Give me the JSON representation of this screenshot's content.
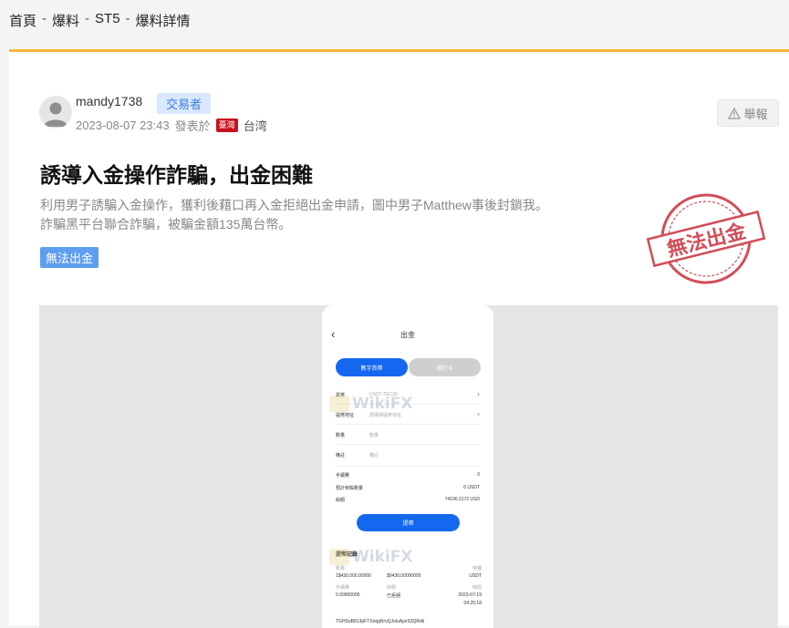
{
  "breadcrumb": {
    "items": [
      "首頁",
      "爆料",
      "ST5",
      "爆料詳情"
    ],
    "separator": "-"
  },
  "post": {
    "author": "mandy1738",
    "role": "交易者",
    "datetime": "2023-08-07 23:43",
    "posted_at_label": "發表於",
    "flag_text": "臺灣",
    "region": "台湾",
    "report_label": "舉報",
    "title": "誘導入金操作詐騙，出金困難",
    "description_line1": "利用男子誘騙入金操作，獲利後藉口再入金拒絕出金申請，圖中男子Matthew事後封鎖我。",
    "description_line2": "詐騙黑平台聯合詐騙，被騙金額135萬台幣。",
    "tag": "無法出金",
    "stamp_text": "無法出金"
  },
  "phone_screen": {
    "title": "出金",
    "back_icon": "chevron-left-icon",
    "tab_active": "數字貨幣",
    "tab_inactive": "銀行卡",
    "rows": [
      {
        "label": "貨幣",
        "value": "USDT-TRC20"
      },
      {
        "label": "提幣地址",
        "value": "請選擇提幣地址"
      },
      {
        "label": "數量",
        "value": "數量"
      },
      {
        "label": "備註",
        "value": "備註"
      }
    ],
    "kv": [
      {
        "k": "手續費",
        "v": "0"
      },
      {
        "k": "預計到賬數量",
        "v": "0 USDT"
      },
      {
        "k": "餘額",
        "v": "74190.3172 USD"
      }
    ],
    "submit": "提幣",
    "history_title": "提幣記錄",
    "records": [
      {
        "a": "數量",
        "b": "",
        "c": "幣種"
      },
      {
        "a": "1$430,000.00000",
        "b": "$0430,00000000",
        "c": "USDT"
      },
      {
        "a": "手續費",
        "b": "狀態",
        "c": "時間"
      },
      {
        "a": "0.00000000",
        "b": "已拒絕",
        "c": "2023-07-19"
      },
      {
        "a": "",
        "b": "",
        "c": "04:25:18"
      }
    ],
    "address": "TGHSuB813pFTSnqgNrvQJstuApxS3QRdk"
  },
  "watermark": "WikiFX",
  "colors": {
    "accent_bar": "#f3b73c",
    "badge_blue_bg": "#d9e8fb",
    "badge_blue_text": "#3d7ee0",
    "tag_blue": "#5e9ef0",
    "flag_red": "#c8121d",
    "stamp_red": "#c9303b",
    "phone_blue": "#1468f0"
  }
}
